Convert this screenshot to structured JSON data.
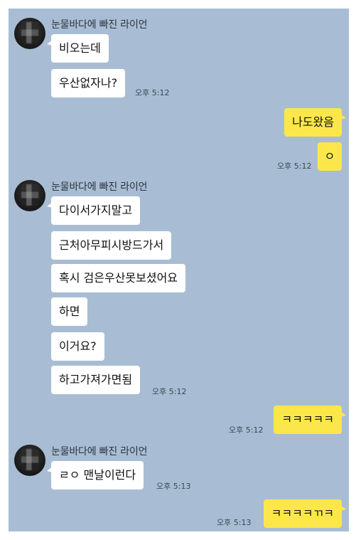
{
  "colors": {
    "chat_background": "#a8bdd3",
    "incoming_bubble": "#ffffff",
    "outgoing_bubble": "#fbe74a"
  },
  "groups": [
    {
      "sender": "눈물바다에 빠진 라이언",
      "messages": [
        "비오는데",
        "우산없자나?"
      ],
      "time": "오후 5:12"
    },
    {
      "outgoing": true,
      "messages": [
        "나도왔음",
        "ㅇ"
      ],
      "time": "오후 5:12"
    },
    {
      "sender": "눈물바다에 빠진 라이언",
      "messages": [
        "다이서가지말고",
        "근처아무피시방드가서",
        "혹시 검은우산못보셨어요",
        "하면",
        "이거요?",
        "하고가져가면됨"
      ],
      "time": "오후 5:12"
    },
    {
      "outgoing": true,
      "messages": [
        "ㅋㅋㅋㅋㅋ"
      ],
      "time": "오후 5:12"
    },
    {
      "sender": "눈물바다에 빠진 라이언",
      "messages": [
        "ㄹㅇ 맨날이런다"
      ],
      "time": "오후 5:13"
    },
    {
      "outgoing": true,
      "messages": [
        "ㅋㅋㅋㅋㄲㅋ"
      ],
      "time": "오후 5:13"
    }
  ]
}
